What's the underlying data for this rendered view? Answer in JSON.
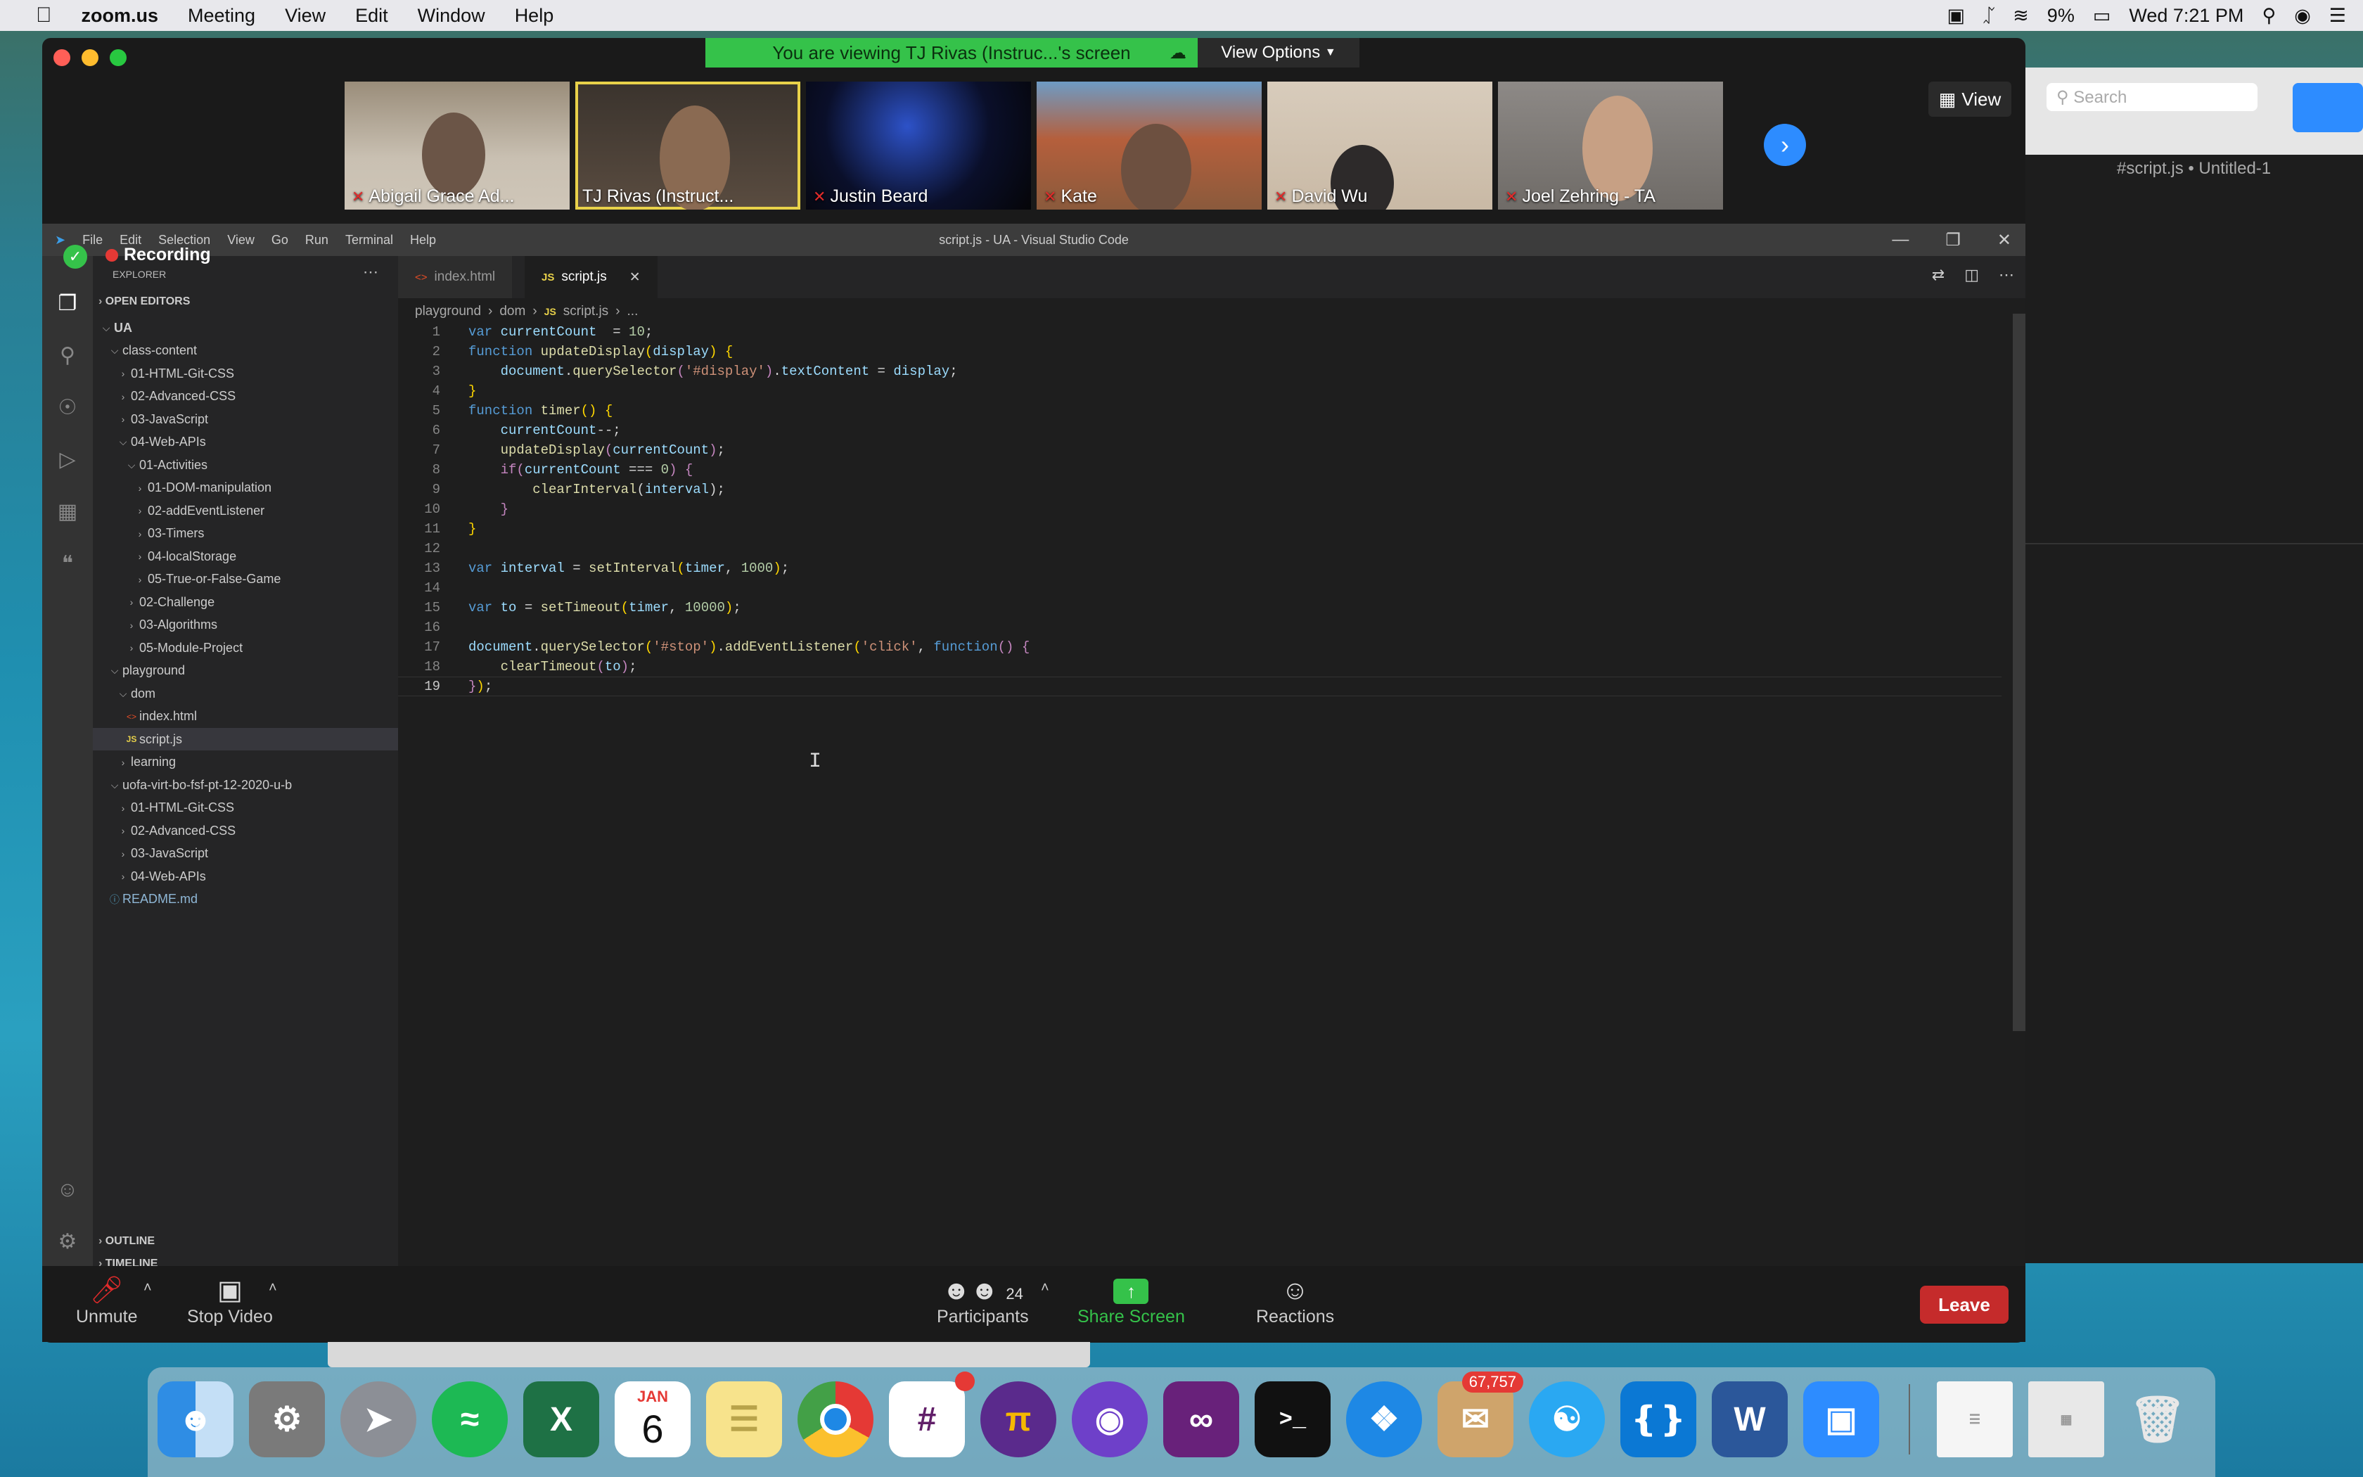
{
  "menubar": {
    "app_name": "zoom.us",
    "items": [
      "Meeting",
      "View",
      "Edit",
      "Window",
      "Help"
    ],
    "battery": "9%",
    "clock": "Wed 7:21 PM"
  },
  "zoom": {
    "banner_text": "You are viewing TJ Rivas (Instruc...'s screen",
    "view_options_label": "View Options",
    "view_label": "View",
    "participants": [
      {
        "name": "Abigail Grace Ad...",
        "muted": true
      },
      {
        "name": "TJ Rivas (Instruct...",
        "muted": false
      },
      {
        "name": "Justin Beard",
        "muted": true
      },
      {
        "name": "Kate",
        "muted": true
      },
      {
        "name": "David Wu",
        "muted": true
      },
      {
        "name": "Joel Zehring - TA",
        "muted": true
      }
    ],
    "recording_label": "Recording",
    "controls": {
      "unmute": "Unmute",
      "stop_video": "Stop Video",
      "participants": "Participants",
      "participant_count": "24",
      "share_screen": "Share Screen",
      "reactions": "Reactions",
      "leave": "Leave"
    },
    "bg_window_title": "#script.js • Untitled-1",
    "bg_search_placeholder": "Search"
  },
  "vscode": {
    "menu": [
      "File",
      "Edit",
      "Selection",
      "View",
      "Go",
      "Run",
      "Terminal",
      "Help"
    ],
    "title": "script.js - UA - Visual Studio Code",
    "explorer_label": "EXPLORER",
    "open_editors": "OPEN EDITORS",
    "outline": "OUTLINE",
    "timeline": "TIMELINE",
    "tree": [
      {
        "label": "UA",
        "depth": 0,
        "chev": "v",
        "type": "root"
      },
      {
        "label": "class-content",
        "depth": 1,
        "chev": "v",
        "type": "folder"
      },
      {
        "label": "01-HTML-Git-CSS",
        "depth": 2,
        "chev": ">",
        "type": "folder"
      },
      {
        "label": "02-Advanced-CSS",
        "depth": 2,
        "chev": ">",
        "type": "folder"
      },
      {
        "label": "03-JavaScript",
        "depth": 2,
        "chev": ">",
        "type": "folder"
      },
      {
        "label": "04-Web-APIs",
        "depth": 2,
        "chev": "v",
        "type": "folder"
      },
      {
        "label": "01-Activities",
        "depth": 3,
        "chev": "v",
        "type": "folder"
      },
      {
        "label": "01-DOM-manipulation",
        "depth": 4,
        "chev": ">",
        "type": "folder"
      },
      {
        "label": "02-addEventListener",
        "depth": 4,
        "chev": ">",
        "type": "folder"
      },
      {
        "label": "03-Timers",
        "depth": 4,
        "chev": ">",
        "type": "folder"
      },
      {
        "label": "04-localStorage",
        "depth": 4,
        "chev": ">",
        "type": "folder"
      },
      {
        "label": "05-True-or-False-Game",
        "depth": 4,
        "chev": ">",
        "type": "folder"
      },
      {
        "label": "02-Challenge",
        "depth": 3,
        "chev": ">",
        "type": "folder"
      },
      {
        "label": "03-Algorithms",
        "depth": 3,
        "chev": ">",
        "type": "folder"
      },
      {
        "label": "05-Module-Project",
        "depth": 3,
        "chev": ">",
        "type": "folder"
      },
      {
        "label": "playground",
        "depth": 1,
        "chev": "v",
        "type": "folder"
      },
      {
        "label": "dom",
        "depth": 2,
        "chev": "v",
        "type": "folder"
      },
      {
        "label": "index.html",
        "depth": 3,
        "chev": "",
        "type": "html"
      },
      {
        "label": "script.js",
        "depth": 3,
        "chev": "",
        "type": "js",
        "selected": true
      },
      {
        "label": "learning",
        "depth": 2,
        "chev": ">",
        "type": "folder"
      },
      {
        "label": "uofa-virt-bo-fsf-pt-12-2020-u-b",
        "depth": 1,
        "chev": "v",
        "type": "folder"
      },
      {
        "label": "01-HTML-Git-CSS",
        "depth": 2,
        "chev": ">",
        "type": "folder"
      },
      {
        "label": "02-Advanced-CSS",
        "depth": 2,
        "chev": ">",
        "type": "folder"
      },
      {
        "label": "03-JavaScript",
        "depth": 2,
        "chev": ">",
        "type": "folder"
      },
      {
        "label": "04-Web-APIs",
        "depth": 2,
        "chev": ">",
        "type": "folder"
      },
      {
        "label": "README.md",
        "depth": 1,
        "chev": "",
        "type": "md"
      }
    ],
    "tabs": [
      {
        "label": "index.html",
        "icon": "<>",
        "active": false
      },
      {
        "label": "script.js",
        "icon": "JS",
        "active": true
      }
    ],
    "breadcrumb": [
      "playground",
      "dom",
      "script.js",
      "..."
    ],
    "code_lines": [
      [
        [
          "kw",
          "var "
        ],
        [
          "vr",
          "currentCount"
        ],
        [
          "",
          "  = "
        ],
        [
          "nm",
          "10"
        ],
        [
          "",
          ";"
        ]
      ],
      [
        [
          "kw",
          "function "
        ],
        [
          "fn",
          "updateDisplay"
        ],
        [
          "pu",
          "("
        ],
        [
          "vr",
          "display"
        ],
        [
          "pu",
          ")"
        ],
        [
          "",
          " "
        ],
        [
          "pu",
          "{"
        ]
      ],
      [
        [
          "",
          "    "
        ],
        [
          "vr",
          "document"
        ],
        [
          "",
          "."
        ],
        [
          "fn",
          "querySelector"
        ],
        [
          "cf",
          "("
        ],
        [
          "st",
          "'#display'"
        ],
        [
          "cf",
          ")"
        ],
        [
          "",
          "."
        ],
        [
          "vr",
          "textContent"
        ],
        [
          "",
          " = "
        ],
        [
          "vr",
          "display"
        ],
        [
          "",
          ";"
        ]
      ],
      [
        [
          "pu",
          "}"
        ]
      ],
      [
        [
          "kw",
          "function "
        ],
        [
          "fn",
          "timer"
        ],
        [
          "pu",
          "()"
        ],
        [
          "",
          " "
        ],
        [
          "pu",
          "{"
        ]
      ],
      [
        [
          "",
          "    "
        ],
        [
          "vr",
          "currentCount"
        ],
        [
          "",
          "--;"
        ]
      ],
      [
        [
          "",
          "    "
        ],
        [
          "fn",
          "updateDisplay"
        ],
        [
          "cf",
          "("
        ],
        [
          "vr",
          "currentCount"
        ],
        [
          "cf",
          ")"
        ],
        [
          "",
          ";"
        ]
      ],
      [
        [
          "",
          "    "
        ],
        [
          "cf",
          "if"
        ],
        [
          "cf",
          "("
        ],
        [
          "vr",
          "currentCount"
        ],
        [
          "",
          " === "
        ],
        [
          "nm",
          "0"
        ],
        [
          "cf",
          ")"
        ],
        [
          "",
          " "
        ],
        [
          "cf",
          "{"
        ]
      ],
      [
        [
          "",
          "        "
        ],
        [
          "fn",
          "clearInterval"
        ],
        [
          "",
          "("
        ],
        [
          "vr",
          "interval"
        ],
        [
          "",
          ");"
        ]
      ],
      [
        [
          "",
          "    "
        ],
        [
          "cf",
          "}"
        ]
      ],
      [
        [
          "pu",
          "}"
        ]
      ],
      [
        [
          "",
          ""
        ]
      ],
      [
        [
          "kw",
          "var "
        ],
        [
          "vr",
          "interval"
        ],
        [
          "",
          " = "
        ],
        [
          "fn",
          "setInterval"
        ],
        [
          "pu",
          "("
        ],
        [
          "vr",
          "timer"
        ],
        [
          "",
          ", "
        ],
        [
          "nm",
          "1000"
        ],
        [
          "pu",
          ")"
        ],
        [
          "",
          ";"
        ]
      ],
      [
        [
          "",
          ""
        ]
      ],
      [
        [
          "kw",
          "var "
        ],
        [
          "vr",
          "to"
        ],
        [
          "",
          " = "
        ],
        [
          "fn",
          "setTimeout"
        ],
        [
          "pu",
          "("
        ],
        [
          "vr",
          "timer"
        ],
        [
          "",
          ", "
        ],
        [
          "nm",
          "10000"
        ],
        [
          "pu",
          ")"
        ],
        [
          "",
          ";"
        ]
      ],
      [
        [
          "",
          ""
        ]
      ],
      [
        [
          "vr",
          "document"
        ],
        [
          "",
          "."
        ],
        [
          "fn",
          "querySelector"
        ],
        [
          "pu",
          "("
        ],
        [
          "st",
          "'#stop'"
        ],
        [
          "pu",
          ")"
        ],
        [
          "",
          "."
        ],
        [
          "fn",
          "addEventListener"
        ],
        [
          "pu",
          "("
        ],
        [
          "st",
          "'click'"
        ],
        [
          "",
          ", "
        ],
        [
          "kw",
          "function"
        ],
        [
          "cf",
          "()"
        ],
        [
          "",
          " "
        ],
        [
          "cf",
          "{"
        ]
      ],
      [
        [
          "",
          "    "
        ],
        [
          "fn",
          "clearTimeout"
        ],
        [
          "cf",
          "("
        ],
        [
          "vr",
          "to"
        ],
        [
          "cf",
          ")"
        ],
        [
          "",
          ";"
        ]
      ],
      [
        [
          "cf",
          "}"
        ],
        [
          "pu",
          ")"
        ],
        [
          "",
          ";"
        ]
      ]
    ]
  },
  "dock": {
    "calendar_month": "JAN",
    "calendar_day": "6",
    "mail_badge": "67,757"
  },
  "colors": {
    "zoom_green": "#35c24a",
    "zoom_blue": "#2d8cff",
    "leave_red": "#c52b2b",
    "vscode_bg": "#1e1e1e"
  }
}
